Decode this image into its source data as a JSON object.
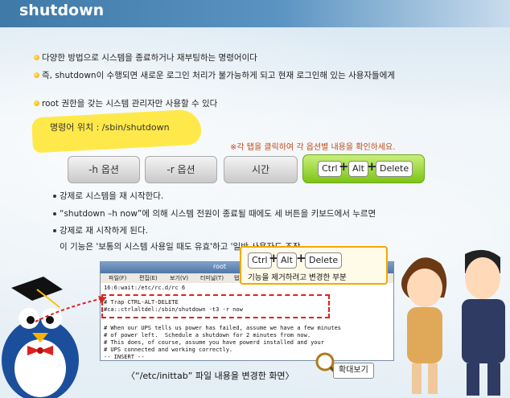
{
  "header": {
    "title": "shutdown"
  },
  "bullets": [
    "다양한 방법으로 시스템을 종료하거나 재부팅하는 명령어이다",
    "즉, shutdown이 수행되면 새로운 로그인 처리가 불가능하게 되고 현재 로그인해 있는 사용자들에게",
    "root 권한을 갖는 시스템 관리자만 사용할 수 있다"
  ],
  "command_location": "명령어 위치 : /sbin/shutdown",
  "notice": "※각 탭을 클릭하여 각 옵션별 내용을 확인하세요.",
  "tabs": [
    {
      "label": "-h 옵션"
    },
    {
      "label": "-r 옵션"
    },
    {
      "label": "시간"
    }
  ],
  "active_tab": {
    "key1": "Ctrl",
    "key2": "Alt",
    "key3": "Delete",
    "plus": "+"
  },
  "content": {
    "line1": "강제로 시스템을 재 시작한다.",
    "line2": "“shutdown –h now”에 의해 시스템 전원이 종료될 때에도 세 버튼을 키보드에서 누르면",
    "line3": "강제로 재 시작하게 된다.",
    "line4": "이 기능은 '보통의 시스템 사용일 때도 유효'하고 '일반 사용자도 조작"
  },
  "terminal": {
    "title": "root",
    "menu": [
      "파일(F)",
      "편집(E)",
      "보기(V)",
      "터미널(T)",
      "탭"
    ],
    "lines": [
      "16:6:wait:/etc/rc.d/rc 6",
      "",
      "# Trap CTRL-ALT-DELETE",
      "#ca::ctrlaltdel:/sbin/shutdown -t3 -r now",
      "",
      "# When our UPS tells us power has failed, assume we have a few minutes",
      "# of power left.  Schedule a shutdown for 2 minutes from now.",
      "# This does, of course, assume you have powerd installed and your",
      "# UPS connected and working correctly.",
      "-- INSERT --"
    ]
  },
  "tooltip": {
    "key1": "Ctrl",
    "key2": "Alt",
    "key3": "Delete",
    "plus": "+",
    "text": "기능을 제거하려고 변경한 부분"
  },
  "caption": "〈“/etc/inittab” 파일 내용을 변경한 화면〉",
  "zoom_label": "확대보기",
  "colors": {
    "header": "#3e79a8",
    "accent_yellow": "#ffe94a",
    "active_tab": "#7cc414",
    "highlight_red": "#e02020"
  }
}
